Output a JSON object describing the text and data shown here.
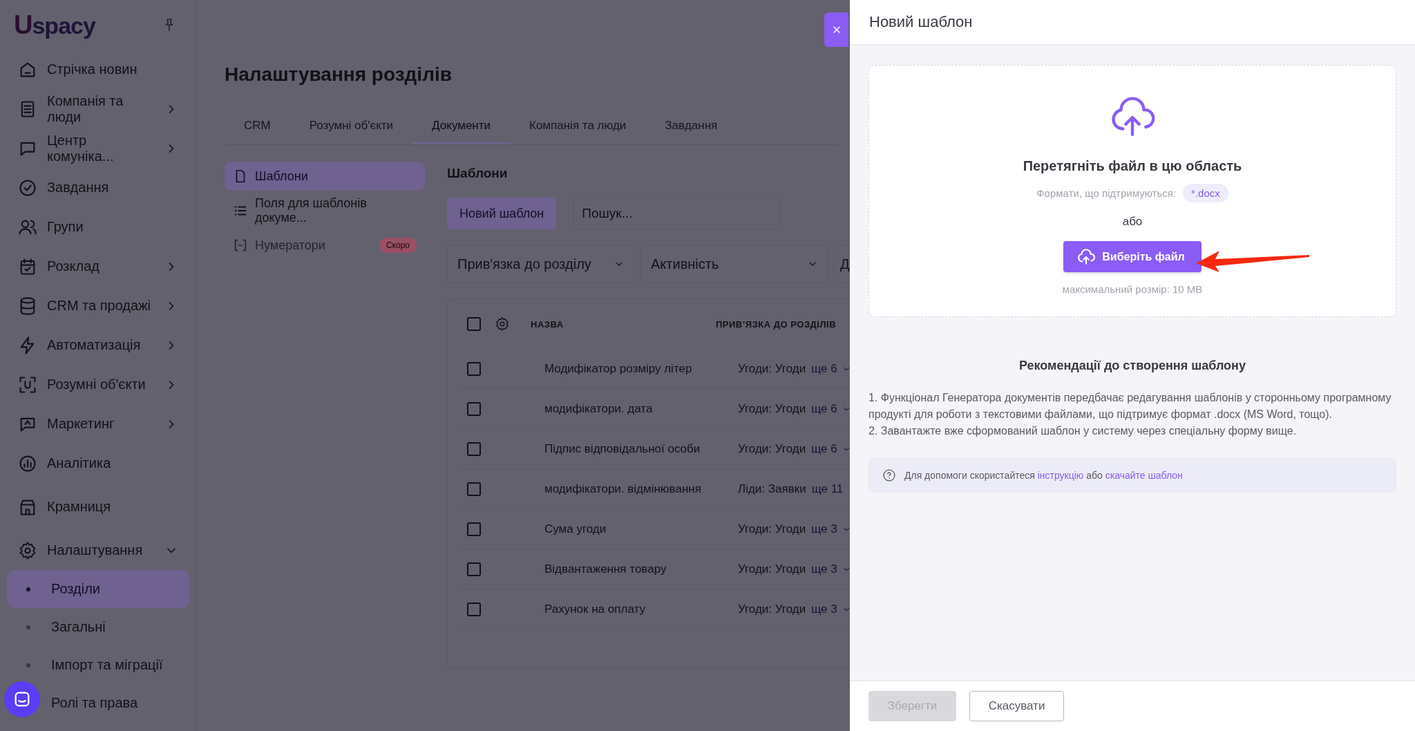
{
  "sidebar": {
    "logo": "Uspacy",
    "items": [
      {
        "label": "Стрічка новин",
        "expandable": false
      },
      {
        "label": "Компанія та люди",
        "expandable": true
      },
      {
        "label": "Центр комуніка...",
        "expandable": true
      },
      {
        "label": "Завдання",
        "expandable": false
      },
      {
        "label": "Групи",
        "expandable": false
      },
      {
        "label": "Розклад",
        "expandable": true
      },
      {
        "label": "CRM та продажі",
        "expandable": true
      },
      {
        "label": "Автоматизація",
        "expandable": true
      },
      {
        "label": "Розумні об'єкти",
        "expandable": true
      },
      {
        "label": "Маркетинг",
        "expandable": true
      },
      {
        "label": "Аналітика",
        "expandable": false
      },
      {
        "label": "Крамниця",
        "expandable": false
      },
      {
        "label": "Налаштування",
        "expandable": true,
        "expanded": true,
        "children": [
          {
            "label": "Розділи",
            "selected": true
          },
          {
            "label": "Загальні",
            "selected": false
          },
          {
            "label": "Імпорт та міграції",
            "selected": false
          },
          {
            "label": "Ролі та права",
            "selected": false
          }
        ]
      }
    ]
  },
  "page": {
    "title": "Налаштування розділів",
    "tabs": [
      {
        "label": "CRM",
        "selected": false
      },
      {
        "label": "Розумні об'єкти",
        "selected": false
      },
      {
        "label": "Документи",
        "selected": true
      },
      {
        "label": "Компанія та люди",
        "selected": false
      },
      {
        "label": "Завдання",
        "selected": false
      }
    ],
    "subnav": [
      {
        "label": "Шаблони",
        "selected": true
      },
      {
        "label": "Поля для шаблонів докуме...",
        "selected": false
      },
      {
        "label": "Нумератори",
        "selected": false,
        "disabled": true,
        "badge": "Скоро"
      }
    ],
    "section_title": "Шаблони",
    "new_button": "Новий шаблон",
    "search": {
      "placeholder": "Пошук..."
    },
    "filters": [
      "Прив'язка до розділу",
      "Активність",
      "Д"
    ],
    "table": {
      "select_all_checked": false,
      "columns": [
        "НАЗВА",
        "ПРИВ’ЯЗКА ДО РОЗДІЛІВ"
      ],
      "rows": [
        {
          "name": "Модифікатор розміру літер",
          "binding": "Угоди: Угоди",
          "more": "ще 6",
          "checked": false
        },
        {
          "name": "модифікатори. дата",
          "binding": "Угоди: Угоди",
          "more": "ще 6",
          "checked": false
        },
        {
          "name": "Підпис відповідальної особи",
          "binding": "Угоди: Угоди",
          "more": "ще 6",
          "checked": false
        },
        {
          "name": "модифікатори. відмінювання",
          "binding": "Ліди: Заявки",
          "more": "ще 11",
          "checked": false
        },
        {
          "name": "Сума угоди",
          "binding": "Угоди: Угоди",
          "more": "ще 3",
          "checked": false
        },
        {
          "name": "Відвантаження товару",
          "binding": "Угоди: Угоди",
          "more": "ще 3",
          "checked": false
        },
        {
          "name": "Рахунок на оплату",
          "binding": "Угоди: Угоди",
          "more": "ще 3",
          "checked": false
        }
      ]
    }
  },
  "panel": {
    "title": "Новий шаблон",
    "dropzone": {
      "title": "Перетягніть файл в цю область",
      "formats_label": "Формати, що підтримуються:",
      "format": "*.docx",
      "or": "або",
      "button": "Виберіть файл",
      "max_size": "максимальний розмір: 10 MB"
    },
    "recommendations": {
      "title": "Рекомендації до створення шаблону",
      "items": [
        "1. Функціонал Генератора документів передбачає редагування шаблонів у сторонньому програмному продукті для роботи з текстовими файлами, що підтримує формат .docx (MS Word, тощо).",
        "2. Завантажте вже сформований шаблон у систему через спеціальну форму вище."
      ]
    },
    "help": {
      "text": "Для допомоги скористайтеся",
      "link": "інструкцію",
      "middle": "або",
      "link2": "скачайте шаблон"
    },
    "buttons": [
      {
        "label": "Зберегти",
        "disabled": true
      },
      {
        "label": "Скасувати",
        "disabled": false
      }
    ]
  }
}
